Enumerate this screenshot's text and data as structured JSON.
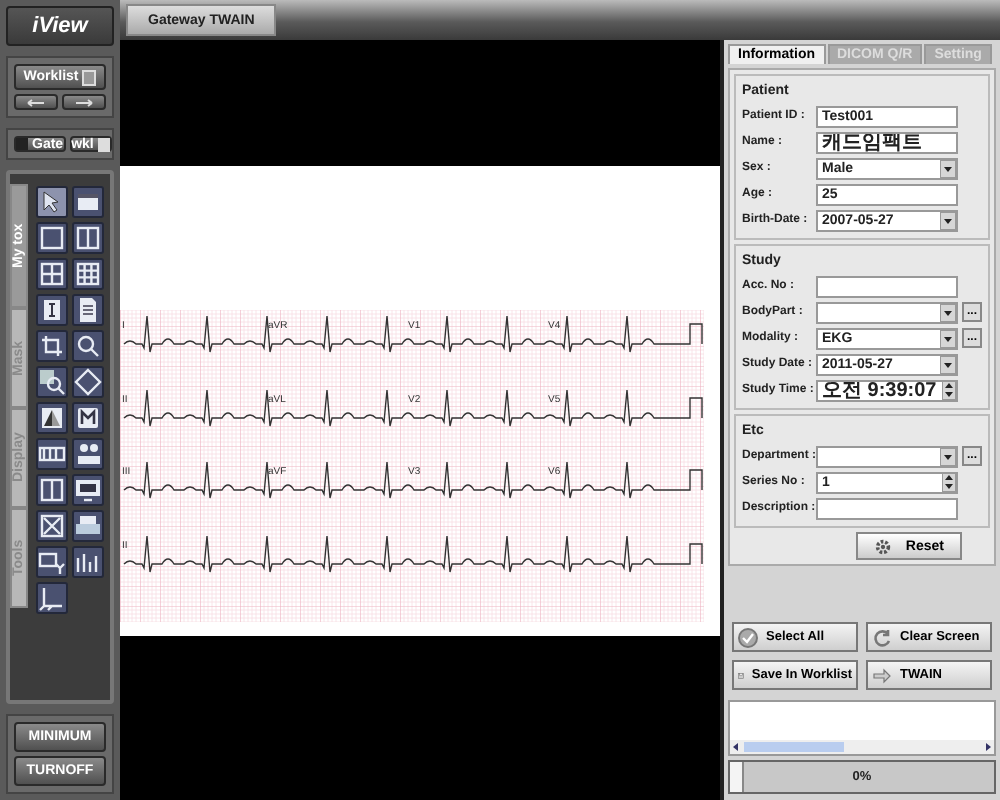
{
  "sidebar": {
    "logo": "iView",
    "worklist_button": "Worklist",
    "gate_button": "Gate",
    "wkl_button": "wkl",
    "vertical_tabs": [
      {
        "label": "My tox",
        "selected": true
      },
      {
        "label": "Mask",
        "selected": false
      },
      {
        "label": "Display",
        "selected": false
      },
      {
        "label": "Tools",
        "selected": false
      }
    ],
    "bottom_buttons": [
      "MINIMUM",
      "TURNOFF"
    ]
  },
  "toolbar": {
    "tabs": [
      {
        "label": "Gateway TWAIN",
        "selected": true
      }
    ]
  },
  "viewer": {
    "leads": [
      [
        "I",
        "aVR",
        "V1",
        "V4"
      ],
      [
        "II",
        "aVL",
        "V2",
        "V5"
      ],
      [
        "III",
        "aVF",
        "V3",
        "V6"
      ],
      [
        "II"
      ]
    ]
  },
  "panel": {
    "tabs": [
      {
        "label": "Information",
        "selected": true
      },
      {
        "label": "DICOM Q/R",
        "selected": false
      },
      {
        "label": "Setting",
        "selected": false
      }
    ],
    "groups": [
      {
        "title": "Patient",
        "fields": [
          {
            "label": "Patient ID :",
            "kind": "text",
            "value": "Test001"
          },
          {
            "label": "Name :",
            "kind": "text",
            "value": "캐드임팩트"
          },
          {
            "label": "Sex :",
            "kind": "combo",
            "value": "Male"
          },
          {
            "label": "Age :",
            "kind": "text",
            "value": "25"
          },
          {
            "label": "Birth-Date :",
            "kind": "combo",
            "value": "2007-05-27"
          }
        ]
      },
      {
        "title": "Study",
        "fields": [
          {
            "label": "Acc. No :",
            "kind": "text"
          },
          {
            "label": "BodyPart :",
            "kind": "combo",
            "button": "..."
          },
          {
            "label": "Modality :",
            "kind": "combo",
            "value": "EKG",
            "button": "..."
          },
          {
            "label": "Study Date :",
            "kind": "combo",
            "value": "2011-05-27"
          },
          {
            "label": "Study Time :",
            "kind": "spin",
            "value": "오전 9:39:07"
          }
        ]
      },
      {
        "title": "Etc",
        "fields": [
          {
            "label": "Department :",
            "kind": "combo",
            "button": "..."
          },
          {
            "label": "Series No :",
            "kind": "spin",
            "value": "1"
          },
          {
            "label": "Description :",
            "kind": "text"
          }
        ]
      }
    ],
    "reset_button": "Reset",
    "buttons": [
      {
        "label": "Select All",
        "kind": "check"
      },
      {
        "label": "Clear Screen",
        "kind": "refresh"
      },
      {
        "label": "Save In Worklist",
        "kind": "save"
      },
      {
        "label": "TWAIN",
        "kind": "arrow"
      }
    ],
    "progress": {
      "level": 0,
      "reading": "0%"
    }
  }
}
